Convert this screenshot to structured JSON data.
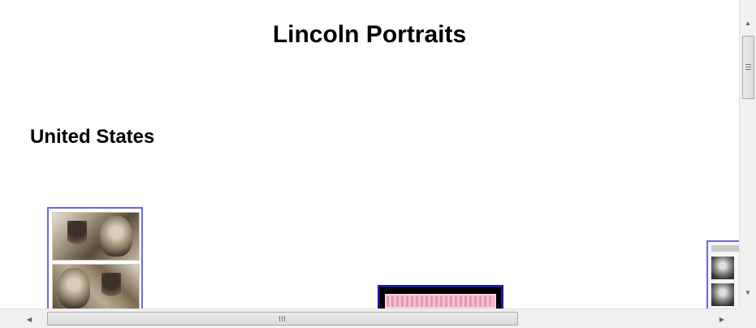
{
  "page": {
    "title": "Lincoln Portraits",
    "section_heading": "United States"
  },
  "thumbnails": [
    {
      "name": "stamp-pair-thumbnail",
      "description_icon": "lincoln-stamp-image"
    },
    {
      "name": "pink-stamp-thumbnail",
      "description_icon": "pink-stamp-image"
    },
    {
      "name": "stamp-sheet-thumbnail",
      "description_icon": "stamp-sheet-image"
    }
  ],
  "scrollbars": {
    "vertical": {
      "up_icon": "arrow-up-icon",
      "down_icon": "arrow-down-icon"
    },
    "horizontal": {
      "left_icon": "arrow-left-icon",
      "right_icon": "arrow-right-icon"
    }
  },
  "colors": {
    "thumb_border": "#6b6bd8",
    "pink_frame": "#1a1a9e",
    "scroll_track": "#f0f0f0"
  }
}
